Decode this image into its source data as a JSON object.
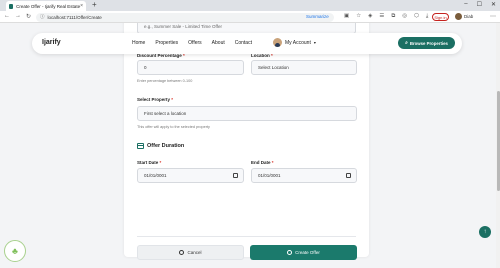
{
  "browser": {
    "tab_title": "Create Offer - Ijarify Real Estate",
    "tab_close": "×",
    "new_tab": "+",
    "url": "localhost:7111/Offer/Create",
    "summarize": "Summarize",
    "sign_in": "Sign in",
    "profile_name": "Diab",
    "win_min": "–",
    "win_max": "☐",
    "win_close": "✕"
  },
  "navbar": {
    "logo": "Ijarify",
    "links": [
      "Home",
      "Properties",
      "Offers",
      "About",
      "Contact"
    ],
    "account_label": "My Account",
    "browse_button": "Browse Properties"
  },
  "form": {
    "title_placeholder": "e.g., Summer Sale - Limited Time Offer",
    "discount_label": "Discount Percentage",
    "discount_value": "0",
    "discount_help": "Enter percentage between 0-100",
    "location_label": "Location",
    "location_value": "Select Location",
    "property_label": "Select Property",
    "property_value": "First select a location",
    "property_help": "This offer will apply to the selected property",
    "duration_title": "Offer Duration",
    "start_label": "Start Date",
    "start_value": "01/01/0001",
    "end_label": "End Date",
    "end_value": "01/01/0001",
    "required_mark": "*",
    "cancel_label": "Cancel",
    "create_label": "Create Offer"
  },
  "colors": {
    "brand": "#1b6f63",
    "required": "#d93025"
  }
}
